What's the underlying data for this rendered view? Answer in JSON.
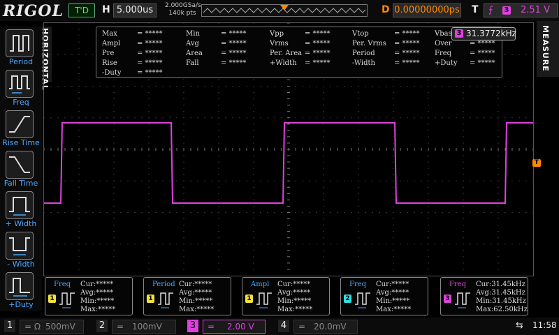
{
  "top": {
    "brand": "RIGOL",
    "run_status": "T'D",
    "h_label": "H",
    "timebase": "5.000us",
    "sample_rate": "2.000GSa/s",
    "mem_depth": "140k pts",
    "d_label": "D",
    "delay": "0.00000000ps",
    "t_label": "T",
    "trigger_channel": "3",
    "trigger_level": "2.51 V"
  },
  "left_menu": {
    "tab": "HORIZONTAL",
    "items": [
      "Period",
      "Freq",
      "Rise Time",
      "Fall Time",
      "+ Width",
      "- Width",
      "+Duty"
    ]
  },
  "right_menu": {
    "tab": "MEASURE"
  },
  "measure_table": {
    "rows": [
      [
        "Max",
        "= *****",
        "Min",
        "= *****",
        "Vpp",
        "= *****",
        "Vtop",
        "= *****",
        "Vbas",
        ""
      ],
      [
        "Ampl",
        "= *****",
        "Avg",
        "= *****",
        "Vrms",
        "= *****",
        "Per. Vrms",
        "= *****",
        "Over",
        "= *****"
      ],
      [
        "Pre",
        "= *****",
        "Area",
        "= *****",
        "Per. Area",
        "= *****",
        "Period",
        "= *****",
        "Freq",
        "= *****"
      ],
      [
        "Rise",
        "= *****",
        "Fall",
        "= *****",
        "+Width",
        "= *****",
        "-Width",
        "= *****",
        "+Duty",
        "= *****"
      ],
      [
        "-Duty",
        "= *****",
        "",
        "",
        "",
        "",
        "",
        "",
        "",
        ""
      ]
    ],
    "freq_badge": "3",
    "freq_value": "31.3772kHz"
  },
  "trigger_marker": "T",
  "bottom_measures": [
    {
      "title": "Freq",
      "channel": "1",
      "cur": "Cur:*****",
      "avg": "Avg:*****",
      "min": "Min:*****",
      "max": "Max:*****"
    },
    {
      "title": "Period",
      "channel": "1",
      "cur": "Cur:*****",
      "avg": "Avg:*****",
      "min": "Min:*****",
      "max": "Max:*****"
    },
    {
      "title": "Ampl",
      "channel": "1",
      "cur": "Cur:*****",
      "avg": "Avg:*****",
      "min": "Min:*****",
      "max": "Max:*****"
    },
    {
      "title": "Freq",
      "channel": "2",
      "cur": "Cur:*****",
      "avg": "Avg:*****",
      "min": "Min:*****",
      "max": "Max:*****"
    },
    {
      "title": "Freq",
      "channel": "3",
      "cur": "Cur:31.45kHz",
      "avg": "Avg:31.45kHz",
      "min": "Min:31.45kHz",
      "max": "Max:62.50kHz"
    }
  ],
  "channels": [
    {
      "num": "1",
      "value": "500mV",
      "prefix": "= Ω"
    },
    {
      "num": "2",
      "value": "100mV",
      "prefix": "="
    },
    {
      "num": "3",
      "value": "2.00 V",
      "prefix": "="
    },
    {
      "num": "4",
      "value": "20.0mV",
      "prefix": "="
    }
  ],
  "clock": "11:58",
  "colors": {
    "ch1": "#f2e23a",
    "ch2": "#2ee0e0",
    "ch3": "#e040e0",
    "ch4": "#3a7cff",
    "accent": "#f80",
    "menu_label": "#4aa8ff"
  }
}
